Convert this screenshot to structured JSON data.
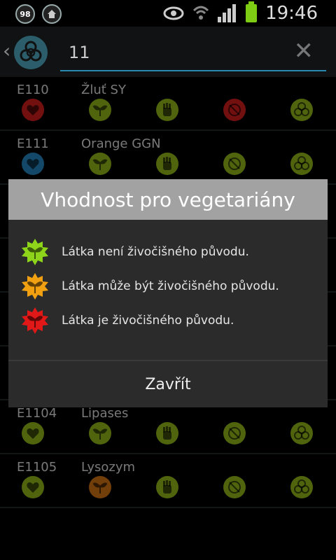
{
  "status_bar": {
    "notification_badge": "98",
    "time": "19:46",
    "battery_color": "#7fcc14"
  },
  "search": {
    "value": "11"
  },
  "rows": [
    {
      "code": "E110",
      "name": "Žluť SY",
      "colors": [
        "#b01818",
        "#7a9a14",
        "#7a9a14",
        "#b01818",
        "#7a9a14"
      ]
    },
    {
      "code": "E111",
      "name": "Orange GGN",
      "colors": [
        "#1e6fa0",
        "#7a9a14",
        "#7a9a14",
        "#7a9a14",
        "#7a9a14"
      ]
    },
    {
      "code": "E1104",
      "name": "Lipases",
      "colors": [
        "#7a9a14",
        "#7a9a14",
        "#7a9a14",
        "#7a9a14",
        "#7a9a14"
      ]
    },
    {
      "code": "E1105",
      "name": "Lysozym",
      "colors": [
        "#7a9a14",
        "#b06010",
        "#7a9a14",
        "#7a9a14",
        "#7a9a14"
      ]
    }
  ],
  "dialog": {
    "title": "Vhodnost pro vegetariány",
    "items": [
      {
        "text": "Látka není živočišného původu.",
        "color": "#8ed41a"
      },
      {
        "text": "Látka může být živočišného původu.",
        "color": "#f0a010"
      },
      {
        "text": "Látka je živočišného původu.",
        "color": "#e01818"
      }
    ],
    "close_label": "Zavřít"
  }
}
